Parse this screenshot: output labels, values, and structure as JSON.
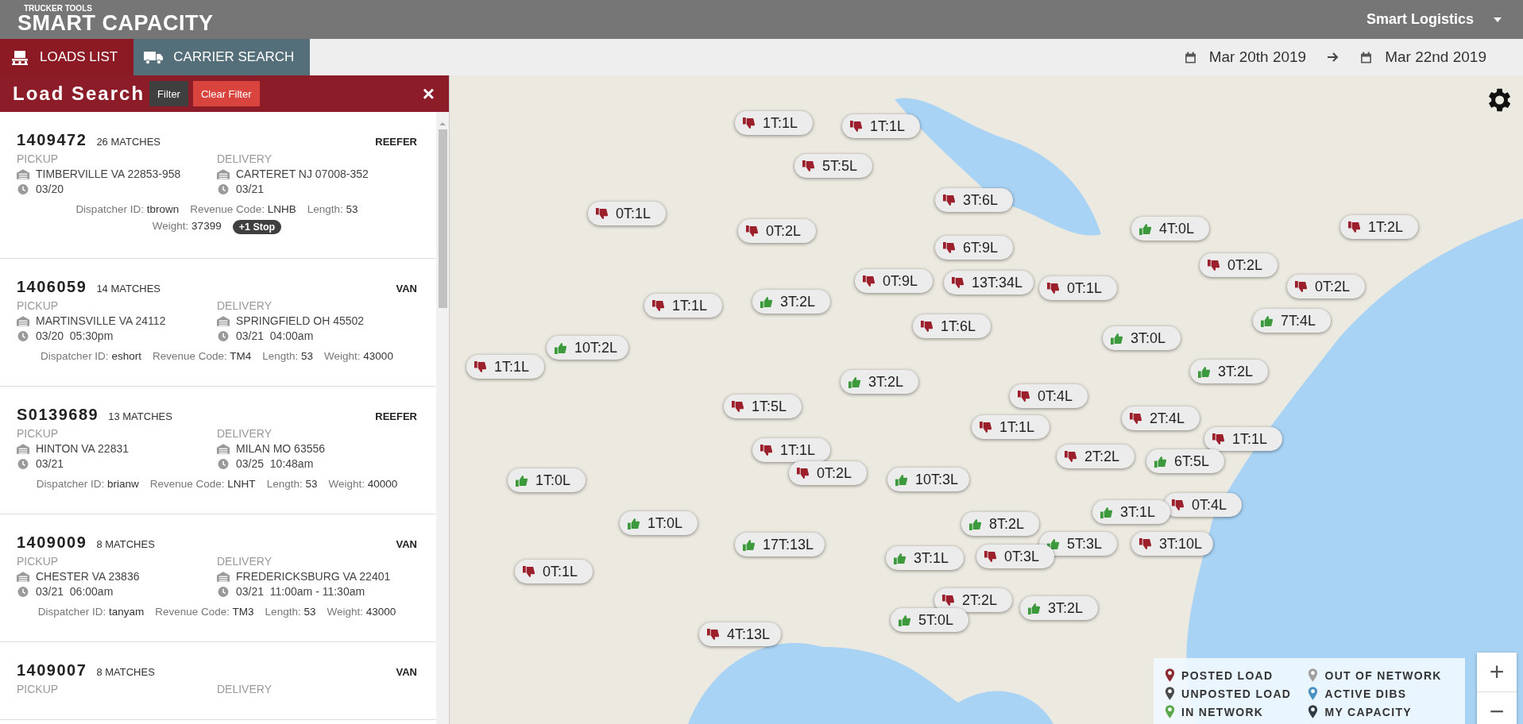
{
  "header": {
    "brand_small": "TRUCKER TOOLS",
    "brand": "SMART CAPACITY",
    "account": "Smart Logistics"
  },
  "tabs": [
    {
      "label": "LOADS LIST",
      "selected": true,
      "kind": "loads"
    },
    {
      "label": "CARRIER SEARCH",
      "selected": false,
      "kind": "carrier"
    }
  ],
  "date_range": {
    "from": "Mar 20th 2019",
    "to": "Mar 22nd 2019"
  },
  "panel": {
    "title": "Load Search",
    "filter": "Filter",
    "clear_filter": "Clear Filter",
    "close": "×"
  },
  "loads": [
    {
      "id": "1409472",
      "matches": "26 MATCHES",
      "equipment": "REEFER",
      "pickup_label": "PICKUP",
      "pickup": "TIMBERVILLE VA 22853-958",
      "pickup_time": "03/20",
      "delivery_label": "DELIVERY",
      "delivery": "CARTERET NJ 07008-352",
      "delivery_time": "03/21",
      "meta": [
        {
          "label": "Dispatcher ID:",
          "value": "tbrown"
        },
        {
          "label": "Revenue Code:",
          "value": "LNHB"
        },
        {
          "label": "Length:",
          "value": "53"
        },
        {
          "label": "Weight:",
          "value": "37399"
        }
      ],
      "stops": "+1 Stop"
    },
    {
      "id": "1406059",
      "matches": "14 MATCHES",
      "equipment": "VAN",
      "pickup_label": "PICKUP",
      "pickup": "MARTINSVILLE VA 24112",
      "pickup_time": "03/20  05:30pm",
      "delivery_label": "DELIVERY",
      "delivery": "SPRINGFIELD OH 45502",
      "delivery_time": "03/21  04:00am",
      "meta": [
        {
          "label": "Dispatcher ID:",
          "value": "eshort"
        },
        {
          "label": "Revenue Code:",
          "value": "TM4"
        },
        {
          "label": "Length:",
          "value": "53"
        },
        {
          "label": "Weight:",
          "value": "43000"
        }
      ]
    },
    {
      "id": "S0139689",
      "matches": "13 MATCHES",
      "equipment": "REEFER",
      "pickup_label": "PICKUP",
      "pickup": "HINTON VA 22831",
      "pickup_time": "03/21",
      "delivery_label": "DELIVERY",
      "delivery": "MILAN MO 63556",
      "delivery_time": "03/25  10:48am",
      "meta": [
        {
          "label": "Dispatcher ID:",
          "value": "brianw"
        },
        {
          "label": "Revenue Code:",
          "value": "LNHT"
        },
        {
          "label": "Length:",
          "value": "53"
        },
        {
          "label": "Weight:",
          "value": "40000"
        }
      ]
    },
    {
      "id": "1409009",
      "matches": "8 MATCHES",
      "equipment": "VAN",
      "pickup_label": "PICKUP",
      "pickup": "CHESTER VA 23836",
      "pickup_time": "03/21  06:00am",
      "delivery_label": "DELIVERY",
      "delivery": "FREDERICKSBURG VA 22401",
      "delivery_time": "03/21  11:00am - 11:30am",
      "meta": [
        {
          "label": "Dispatcher ID:",
          "value": "tanyam"
        },
        {
          "label": "Revenue Code:",
          "value": "TM3"
        },
        {
          "label": "Length:",
          "value": "53"
        },
        {
          "label": "Weight:",
          "value": "43000"
        }
      ]
    },
    {
      "id": "1409007",
      "matches": "8 MATCHES",
      "equipment": "VAN",
      "pickup_label": "PICKUP",
      "delivery_label": "DELIVERY"
    }
  ],
  "map": {
    "pins": [
      {
        "label": "1T:1L",
        "kind": "down"
      },
      {
        "label": "1T:1L",
        "kind": "down"
      },
      {
        "label": "5T:5L",
        "kind": "down"
      },
      {
        "label": "0T:1L",
        "kind": "down"
      },
      {
        "label": "0T:2L",
        "kind": "down"
      },
      {
        "label": "3T:6L",
        "kind": "down"
      },
      {
        "label": "4T:0L",
        "kind": "up"
      },
      {
        "label": "1T:2L",
        "kind": "down"
      },
      {
        "label": "6T:9L",
        "kind": "down"
      },
      {
        "label": "0T:2L",
        "kind": "down"
      },
      {
        "label": "0T:9L",
        "kind": "down"
      },
      {
        "label": "13T:34L",
        "kind": "down"
      },
      {
        "label": "0T:1L",
        "kind": "down"
      },
      {
        "label": "0T:2L",
        "kind": "down"
      },
      {
        "label": "3T:2L",
        "kind": "up"
      },
      {
        "label": "1T:1L",
        "kind": "down"
      },
      {
        "label": "1T:6L",
        "kind": "down"
      },
      {
        "label": "3T:0L",
        "kind": "up"
      },
      {
        "label": "7T:4L",
        "kind": "up"
      },
      {
        "label": "10T:2L",
        "kind": "up"
      },
      {
        "label": "1T:1L",
        "kind": "down"
      },
      {
        "label": "3T:2L",
        "kind": "up"
      },
      {
        "label": "3T:2L",
        "kind": "up"
      },
      {
        "label": "0T:4L",
        "kind": "down"
      },
      {
        "label": "1T:5L",
        "kind": "down"
      },
      {
        "label": "2T:4L",
        "kind": "down"
      },
      {
        "label": "1T:1L",
        "kind": "down"
      },
      {
        "label": "1T:1L",
        "kind": "down"
      },
      {
        "label": "1T:1L",
        "kind": "down"
      },
      {
        "label": "2T:2L",
        "kind": "down"
      },
      {
        "label": "6T:5L",
        "kind": "up"
      },
      {
        "label": "0T:2L",
        "kind": "down"
      },
      {
        "label": "1T:0L",
        "kind": "up"
      },
      {
        "label": "10T:3L",
        "kind": "up"
      },
      {
        "label": "0T:4L",
        "kind": "down"
      },
      {
        "label": "3T:1L",
        "kind": "up"
      },
      {
        "label": "1T:0L",
        "kind": "up"
      },
      {
        "label": "8T:2L",
        "kind": "up"
      },
      {
        "label": "17T:13L",
        "kind": "up"
      },
      {
        "label": "5T:3L",
        "kind": "up"
      },
      {
        "label": "3T:10L",
        "kind": "down"
      },
      {
        "label": "3T:1L",
        "kind": "up"
      },
      {
        "label": "0T:3L",
        "kind": "down"
      },
      {
        "label": "0T:1L",
        "kind": "down"
      },
      {
        "label": "2T:2L",
        "kind": "down"
      },
      {
        "label": "3T:2L",
        "kind": "up"
      },
      {
        "label": "4T:13L",
        "kind": "down"
      },
      {
        "label": "5T:0L",
        "kind": "up"
      }
    ],
    "legend": [
      {
        "label": "POSTED LOAD",
        "color": "#8b2a2f"
      },
      {
        "label": "OUT OF NETWORK",
        "color": "#9e9e9e"
      },
      {
        "label": "UNPOSTED LOAD",
        "color": "#4a4a4a"
      },
      {
        "label": "ACTIVE DIBS",
        "color": "#4a90c2"
      },
      {
        "label": "IN NETWORK",
        "color": "#5aa84a"
      },
      {
        "label": "MY CAPACITY",
        "color": "#2f3b44"
      }
    ],
    "zoom": {
      "in": "+",
      "out": "−"
    }
  }
}
